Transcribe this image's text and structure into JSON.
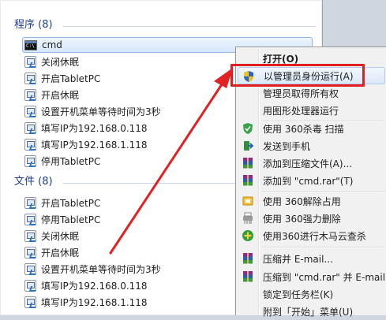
{
  "programs_section": {
    "title": "程序 (8)"
  },
  "files_section": {
    "title": "文件 (8)"
  },
  "programs": [
    {
      "label": "cmd",
      "icon": "cmd-icon"
    },
    {
      "label": "关闭休眠",
      "icon": "shortcut-icon"
    },
    {
      "label": "开启TabletPC",
      "icon": "shortcut-icon"
    },
    {
      "label": "开启休眠",
      "icon": "shortcut-icon"
    },
    {
      "label": "设置开机菜单等待时间为3秒",
      "icon": "shortcut-icon"
    },
    {
      "label": "填写IP为192.168.0.118",
      "icon": "shortcut-icon"
    },
    {
      "label": "填写IP为192.168.1.118",
      "icon": "shortcut-icon"
    },
    {
      "label": "停用TabletPC",
      "icon": "shortcut-icon"
    }
  ],
  "files": [
    {
      "label": "开启TabletPC",
      "icon": "shortcut-icon"
    },
    {
      "label": "停用TabletPC",
      "icon": "shortcut-icon"
    },
    {
      "label": "关闭休眠",
      "icon": "shortcut-icon"
    },
    {
      "label": "开启休眠",
      "icon": "shortcut-icon"
    },
    {
      "label": "设置开机菜单等待时间为3秒",
      "icon": "shortcut-icon"
    },
    {
      "label": "填写IP为192.168.0.118",
      "icon": "shortcut-icon"
    },
    {
      "label": "填写IP为192.168.1.118",
      "icon": "shortcut-icon"
    }
  ],
  "context_menu": {
    "items": [
      {
        "label": "打开(O)",
        "icon": ""
      },
      {
        "label": "以管理员身份运行(A)",
        "icon": "uac-shield-icon"
      },
      {
        "label": "管理员取得所有权",
        "icon": ""
      },
      {
        "label": "用图形处理器运行",
        "icon": ""
      },
      {
        "label": "使用 360杀毒 扫描",
        "icon": "shield-360-icon"
      },
      {
        "label": "发送到手机",
        "icon": "send-phone-icon"
      },
      {
        "label": "添加到压缩文件(A)...",
        "icon": "winrar-icon"
      },
      {
        "label": "添加到 \"cmd.rar\"(T)",
        "icon": "winrar-icon"
      },
      {
        "label": "使用 360解除占用",
        "icon": "unlock-360-icon"
      },
      {
        "label": "使用 360强力删除",
        "icon": "shredder-icon"
      },
      {
        "label": "使用360进行木马云查杀",
        "icon": "trojan-scan-icon"
      },
      {
        "label": "压缩并 E-mail...",
        "icon": "winrar-icon"
      },
      {
        "label": "压缩到 \"cmd.rar\" 并 E-mail",
        "icon": "winrar-icon"
      },
      {
        "label": "锁定到任务栏(K)",
        "icon": ""
      },
      {
        "label": "附到「开始」菜单(U)",
        "icon": ""
      }
    ]
  },
  "colors": {
    "section_title": "#1e3f8a",
    "highlight_box": "#e02020",
    "selection": "#d5e7fb"
  }
}
